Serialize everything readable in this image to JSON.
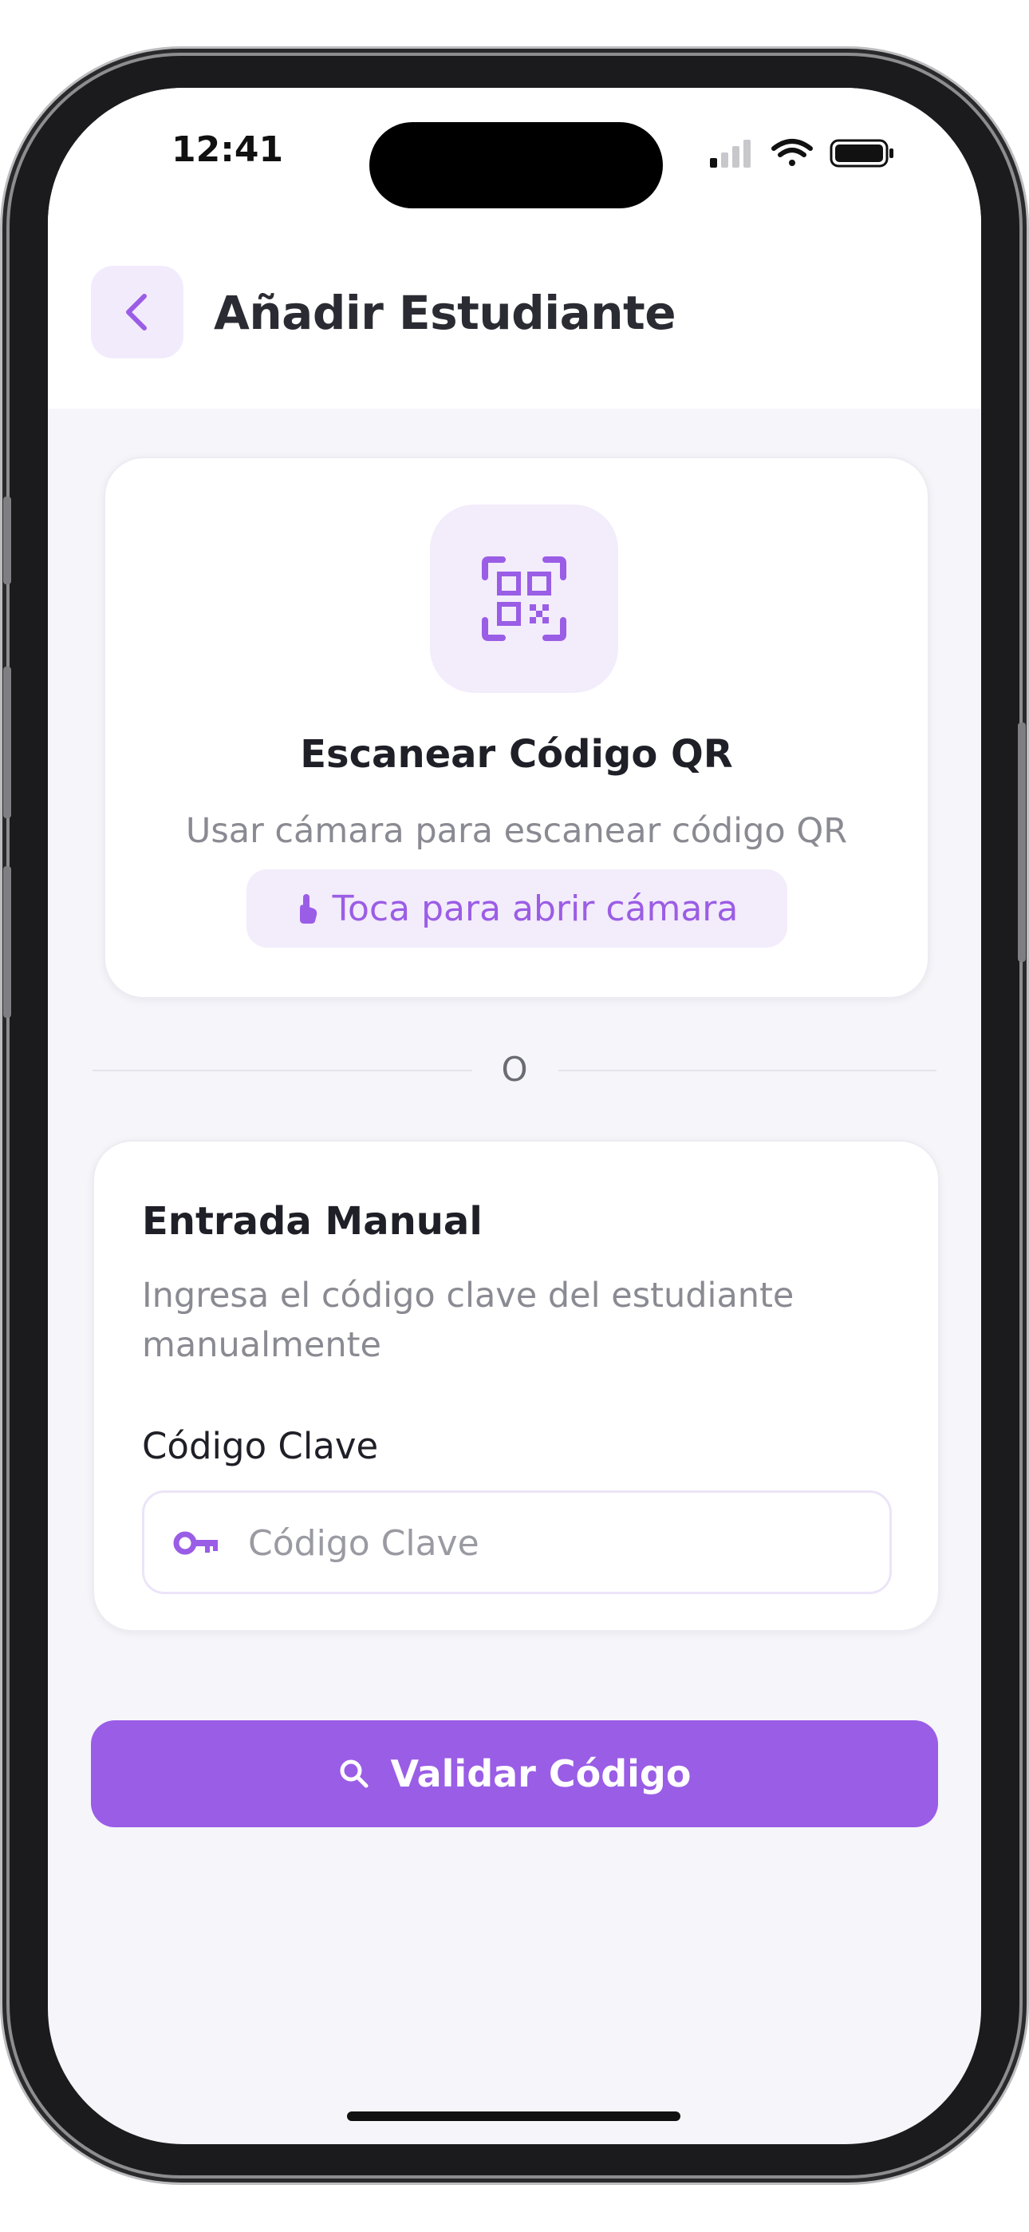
{
  "status_bar": {
    "time": "12:41"
  },
  "header": {
    "title": "Añadir Estudiante",
    "back_icon": "chevron-left-icon"
  },
  "qr_card": {
    "icon": "qr-scan-icon",
    "title": "Escanear Código QR",
    "subtitle": "Usar cámara para escanear código QR",
    "open_icon": "touch-icon",
    "open_label": "Toca para abrir cámara"
  },
  "divider": {
    "label": "O"
  },
  "manual": {
    "title": "Entrada Manual",
    "description": "Ingresa el código clave del estudiante manualmente",
    "field_label": "Código Clave",
    "field_placeholder": "Código Clave",
    "field_value": "",
    "field_icon": "key-icon"
  },
  "validate_button": {
    "label": "Validar Código",
    "icon": "search-icon"
  },
  "colors": {
    "accent": "#9a5de6",
    "accent_light": "#f3ecfb",
    "background": "#f5f5fa"
  }
}
